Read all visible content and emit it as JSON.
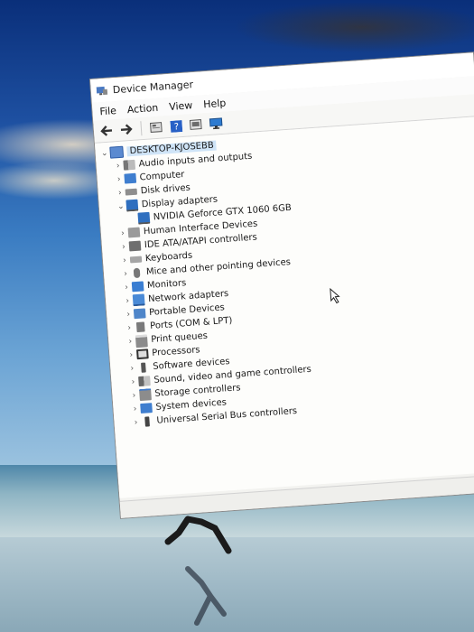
{
  "window": {
    "title": "Device Manager"
  },
  "menu": {
    "items": [
      "File",
      "Action",
      "View",
      "Help"
    ]
  },
  "toolbar": {
    "icons": [
      "back-arrow-icon",
      "forward-arrow-icon",
      "properties-icon",
      "help-icon",
      "update-driver-icon",
      "monitor-icon"
    ]
  },
  "tree": {
    "root": "DESKTOP-KJOSEBB",
    "items": [
      {
        "label": "Audio inputs and outputs",
        "icon": "speaker-icon",
        "expanded": false
      },
      {
        "label": "Computer",
        "icon": "computer-icon",
        "expanded": false
      },
      {
        "label": "Disk drives",
        "icon": "disk-icon",
        "expanded": false
      },
      {
        "label": "Display adapters",
        "icon": "display-adapter-icon",
        "expanded": true,
        "children": [
          {
            "label": "NVIDIA Geforce GTX 1060 6GB",
            "icon": "display-adapter-icon"
          }
        ]
      },
      {
        "label": "Human Interface Devices",
        "icon": "hid-icon",
        "expanded": false
      },
      {
        "label": "IDE ATA/ATAPI controllers",
        "icon": "ide-icon",
        "expanded": false
      },
      {
        "label": "Keyboards",
        "icon": "keyboard-icon",
        "expanded": false
      },
      {
        "label": "Mice and other pointing devices",
        "icon": "mouse-icon",
        "expanded": false
      },
      {
        "label": "Monitors",
        "icon": "monitor-icon",
        "expanded": false
      },
      {
        "label": "Network adapters",
        "icon": "network-icon",
        "expanded": false
      },
      {
        "label": "Portable Devices",
        "icon": "portable-icon",
        "expanded": false
      },
      {
        "label": "Ports (COM & LPT)",
        "icon": "port-icon",
        "expanded": false
      },
      {
        "label": "Print queues",
        "icon": "printer-icon",
        "expanded": false
      },
      {
        "label": "Processors",
        "icon": "processor-icon",
        "expanded": false
      },
      {
        "label": "Software devices",
        "icon": "software-icon",
        "expanded": false
      },
      {
        "label": "Sound, video and game controllers",
        "icon": "sound-icon",
        "expanded": false
      },
      {
        "label": "Storage controllers",
        "icon": "storage-icon",
        "expanded": false
      },
      {
        "label": "System devices",
        "icon": "system-icon",
        "expanded": false
      },
      {
        "label": "Universal Serial Bus controllers",
        "icon": "usb-icon",
        "expanded": false
      }
    ]
  },
  "colors": {
    "selection": "#cfe4f7",
    "icon_blue": "#2f6fbf"
  }
}
